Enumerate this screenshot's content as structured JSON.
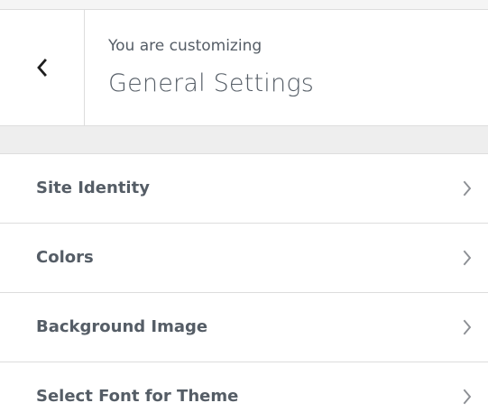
{
  "header": {
    "eyebrow": "You are customizing",
    "title": "General Settings"
  },
  "icons": {
    "back": "chevron-left-icon",
    "item": "chevron-right-icon"
  },
  "colors": {
    "text": "#555d66",
    "border": "#dddddd",
    "panel_bg": "#eeeeee",
    "item_bg": "#ffffff",
    "icon": "#1e1e1e",
    "chevron": "#8c8f94"
  },
  "menu": {
    "items": [
      {
        "label": "Site Identity"
      },
      {
        "label": "Colors"
      },
      {
        "label": "Background Image"
      },
      {
        "label": "Select Font for Theme"
      }
    ]
  }
}
